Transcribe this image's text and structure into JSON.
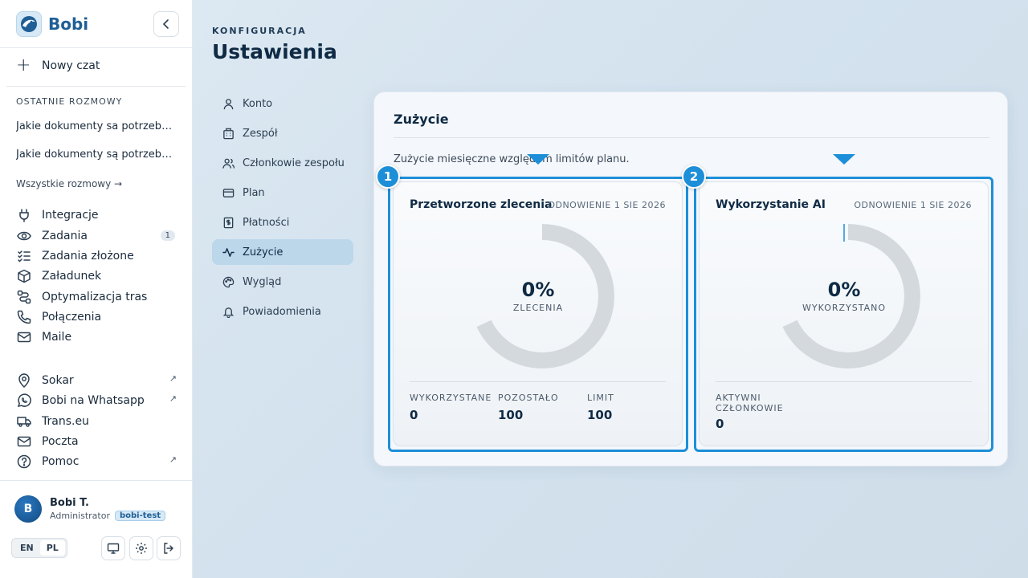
{
  "app": {
    "name": "Bobi"
  },
  "sidebar": {
    "new_chat": "Nowy czat",
    "recent_label": "OSTATNIE ROZMOWY",
    "recent": [
      "Jakie dokumenty sa potrzebne ...",
      "Jakie dokumenty są potrzebne ..."
    ],
    "all_chats": "Wszystkie rozmowy →",
    "nav": [
      {
        "label": "Integracje",
        "icon": "plug-icon"
      },
      {
        "label": "Zadania",
        "icon": "eye-icon",
        "badge": "1"
      },
      {
        "label": "Zadania złożone",
        "icon": "checklist-icon"
      },
      {
        "label": "Załadunek",
        "icon": "box-icon"
      },
      {
        "label": "Optymalizacja tras",
        "icon": "route-icon"
      },
      {
        "label": "Połączenia",
        "icon": "phone-icon"
      },
      {
        "label": "Maile",
        "icon": "mail-icon"
      }
    ],
    "links": [
      {
        "label": "Sokar",
        "icon": "location-icon",
        "external": "↗"
      },
      {
        "label": "Bobi na Whatsapp",
        "icon": "whatsapp-icon",
        "external": "↗"
      },
      {
        "label": "Trans.eu",
        "icon": "truck-icon"
      },
      {
        "label": "Poczta",
        "icon": "mail-icon"
      },
      {
        "label": "Pomoc",
        "icon": "help-icon",
        "external": "↗"
      }
    ],
    "user": {
      "initial": "B",
      "name": "Bobi T.",
      "role": "Administrator",
      "tag": "bobi-test"
    },
    "lang": {
      "en": "EN",
      "pl": "PL",
      "active": "PL"
    }
  },
  "header": {
    "eyebrow": "KONFIGURACJA",
    "title": "Ustawienia"
  },
  "settings_menu": [
    {
      "label": "Konto",
      "icon": "user-icon"
    },
    {
      "label": "Zespół",
      "icon": "building-icon"
    },
    {
      "label": "Członkowie zespołu",
      "icon": "users-icon"
    },
    {
      "label": "Plan",
      "icon": "card-icon"
    },
    {
      "label": "Płatności",
      "icon": "invoice-icon"
    },
    {
      "label": "Zużycie",
      "icon": "activity-icon",
      "active": true
    },
    {
      "label": "Wygląd",
      "icon": "palette-icon"
    },
    {
      "label": "Powiadomienia",
      "icon": "bell-icon"
    }
  ],
  "usage": {
    "title": "Zużycie",
    "subtitle": "Zużycie miesięczne względem limitów planu.",
    "cards": [
      {
        "badge": "1",
        "title": "Przetworzone zlecenia",
        "renewal": "ODNOWIENIE 1 SIE 2026",
        "percent": "0%",
        "percent_label": "ZLECENIA",
        "progress": 0,
        "stats": [
          {
            "label": "WYKORZYSTANE",
            "value": "0"
          },
          {
            "label": "POZOSTAŁO",
            "value": "100"
          },
          {
            "label": "LIMIT",
            "value": "100"
          }
        ]
      },
      {
        "badge": "2",
        "title": "Wykorzystanie AI",
        "renewal": "ODNOWIENIE 1 SIE 2026",
        "percent": "0%",
        "percent_label": "WYKORZYSTANO",
        "progress": 0,
        "stats": [
          {
            "label": "AKTYWNI CZŁONKOWIE",
            "value": "0"
          }
        ]
      }
    ]
  },
  "colors": {
    "accent": "#1d8fd8",
    "brand": "#1f5f96",
    "track": "#d4d9de"
  }
}
